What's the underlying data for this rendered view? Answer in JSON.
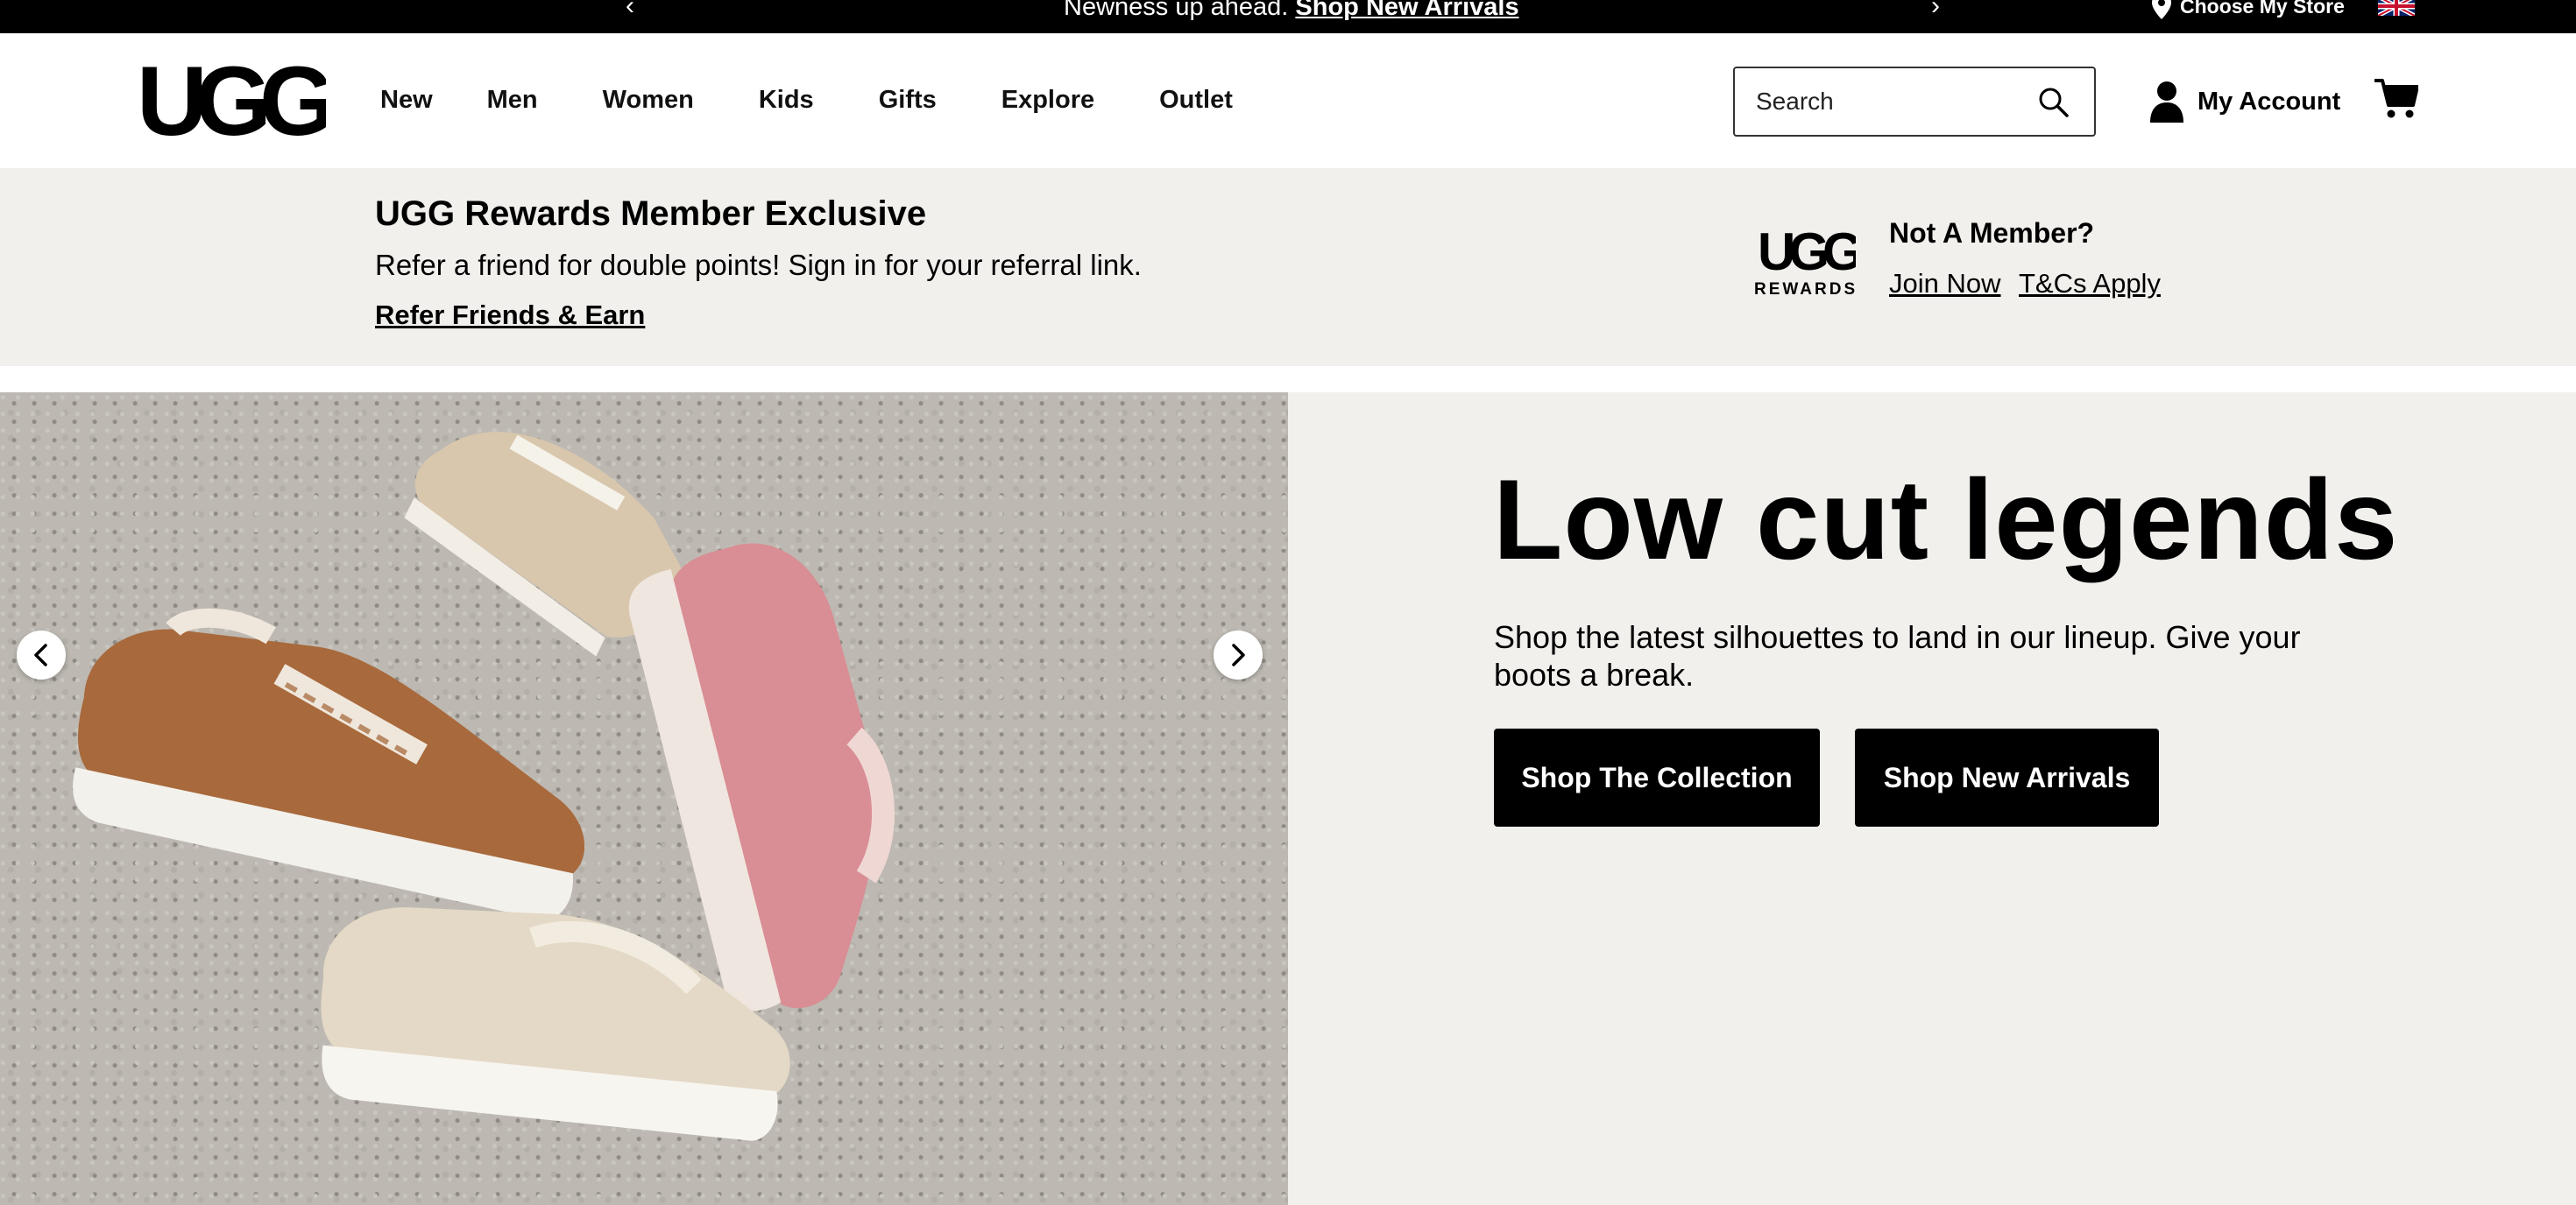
{
  "promo_bar": {
    "prefix_text": "Newness up ahead. ",
    "link_text": "Shop New Arrivals",
    "store_label": "Choose My Store",
    "prev_icon": "chevron-left-icon",
    "next_icon": "chevron-right-icon"
  },
  "header": {
    "logo_text": "UGG",
    "nav": [
      {
        "label": "New"
      },
      {
        "label": "Men"
      },
      {
        "label": "Women"
      },
      {
        "label": "Kids"
      },
      {
        "label": "Gifts"
      },
      {
        "label": "Explore"
      },
      {
        "label": "Outlet"
      }
    ],
    "search": {
      "placeholder": "Search",
      "icon": "search-icon"
    },
    "account_label": "My Account",
    "cart_icon": "cart-icon"
  },
  "rewards": {
    "title": "UGG Rewards Member Exclusive",
    "text": "Refer a friend for double points! Sign in for your referral link.",
    "link": "Refer Friends & Earn",
    "logo_text": "UGG",
    "logo_subtext": "REWARDS",
    "not_member": "Not A Member?",
    "join_label": "Join Now",
    "terms_label": "T&Cs Apply"
  },
  "hero": {
    "title": "Low cut legends",
    "description": "Shop the latest silhouettes to land in our lineup. Give your boots a break.",
    "primary_button": "Shop The Collection",
    "secondary_button": "Shop New Arrivals"
  },
  "colors": {
    "promo_bg": "#000000",
    "banner_bg": "#f2f0ed",
    "button_bg": "#000000",
    "button_text": "#ffffff"
  }
}
